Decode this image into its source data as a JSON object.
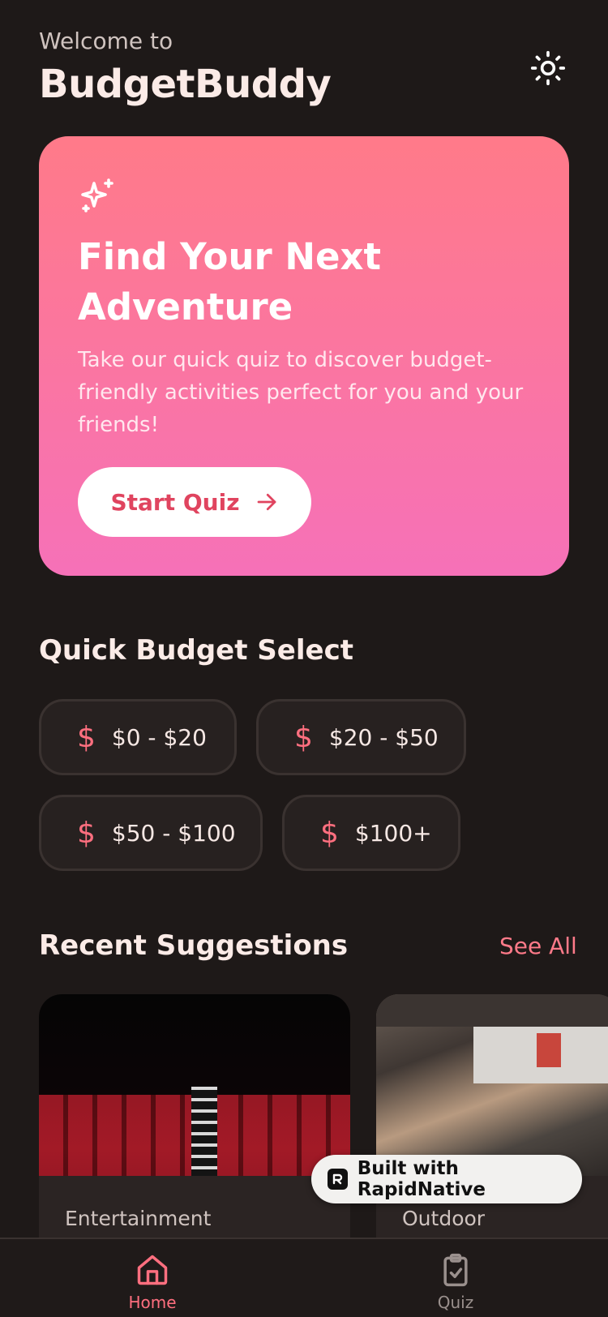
{
  "header": {
    "welcome": "Welcome to",
    "app_title": "BudgetBuddy",
    "theme_icon": "sun-icon"
  },
  "hero": {
    "icon": "sparkles-icon",
    "title": "Find Your Next Adventure",
    "description": "Take our quick quiz to discover budget-friendly activities perfect for you and your friends!",
    "button_label": "Start Quiz",
    "button_icon": "arrow-right-icon",
    "colors": {
      "gradient_top": "#ff7a89",
      "gradient_bottom": "#f671b8",
      "button_text": "#e0445f"
    }
  },
  "budget": {
    "title": "Quick Budget Select",
    "currency_symbol": "$",
    "options": [
      "$0 - $20",
      "$20 - $50",
      "$50 - $100",
      "$100+"
    ]
  },
  "recent": {
    "title": "Recent Suggestions",
    "see_all": "See All",
    "cards": [
      {
        "category": "Entertainment",
        "image": "cinema-seats-photo"
      },
      {
        "category": "Outdoor",
        "image": "outdoor-dining-photo"
      }
    ]
  },
  "badge": {
    "text": "Built with RapidNative",
    "icon": "rapidnative-logo"
  },
  "tabbar": {
    "tabs": [
      {
        "label": "Home",
        "icon": "home-icon",
        "active": true
      },
      {
        "label": "Quiz",
        "icon": "clipboard-check-icon",
        "active": false
      }
    ],
    "active_color": "#ff6f7f",
    "inactive_color": "#9a908d"
  }
}
